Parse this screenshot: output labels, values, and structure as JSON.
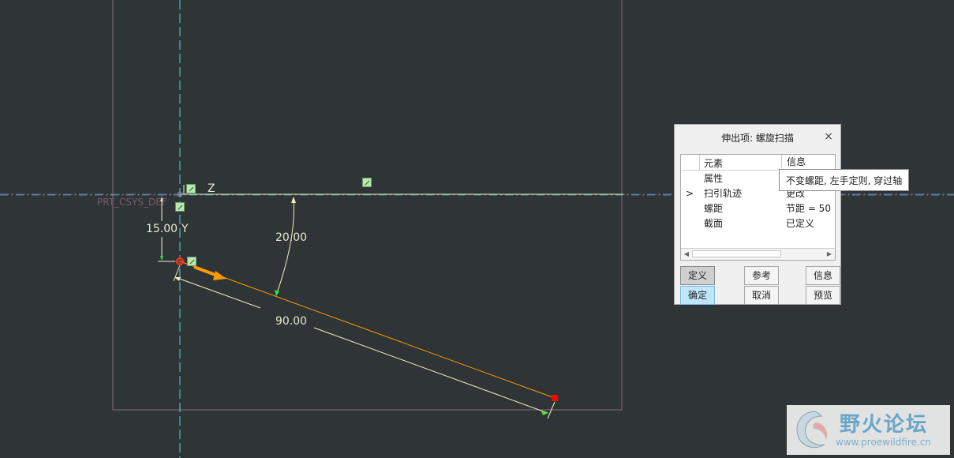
{
  "sketch": {
    "csys_label": "PRT_CSYS_DEF",
    "axis_z_label": "Z",
    "axis_y_label": "Y",
    "dim_vertical": "15.00",
    "dim_angle": "20.00",
    "dim_length": "90.00"
  },
  "dialog": {
    "title": "伸出项: 螺旋扫描",
    "close_label": "×",
    "columns": [
      "元素",
      "信息"
    ],
    "rows": [
      {
        "mark": "",
        "name": "属性",
        "info": ""
      },
      {
        "mark": ">",
        "name": "扫引轨迹",
        "info": "更改"
      },
      {
        "mark": "",
        "name": "螺距",
        "info": "节距 = 50"
      },
      {
        "mark": "",
        "name": "截面",
        "info": "已定义"
      }
    ],
    "buttons": {
      "define": "定义",
      "reference": "参考",
      "info": "信息",
      "ok": "确定",
      "cancel": "取消",
      "preview": "预览"
    },
    "tooltip": "不变螺距, 左手定则, 穿过轴"
  },
  "watermark": {
    "title": "野火论坛",
    "url": "www.proewildfire.cn"
  },
  "colors": {
    "background": "#2f3436",
    "sketch_frame": "#8a6a7e",
    "centerline": "#4fd0d8",
    "dimension": "#f0f0c0",
    "trajectory": "#ff9900",
    "endpoint": "#ff0000",
    "constraint": "#b8e8b0"
  }
}
